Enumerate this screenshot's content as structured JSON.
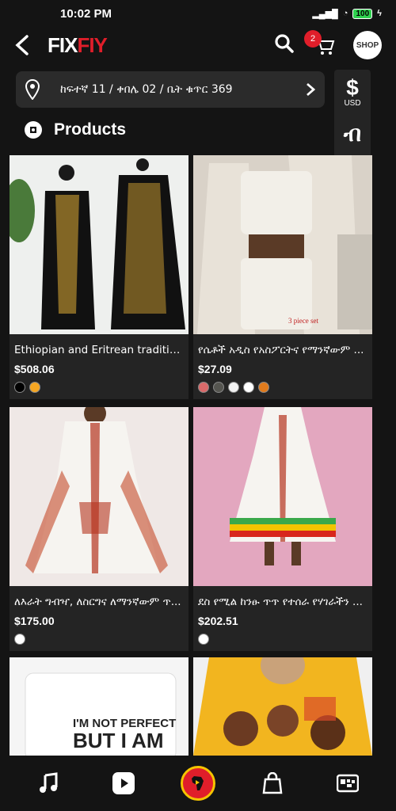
{
  "status": {
    "time": "10:02 PM",
    "battery": "100"
  },
  "header": {
    "logo_a": "FIX",
    "logo_b": "FIY",
    "cart_count": "2",
    "shop_label": "SHOP"
  },
  "address": {
    "text": "ከፍተኛ 11 / ቀበሌ 02 / ቤት ቁጥር 369"
  },
  "currencies": [
    {
      "symbol": "$",
      "label": "USD"
    },
    {
      "symbol": "ብ",
      "label": ""
    },
    {
      "symbol": "£",
      "label": ""
    },
    {
      "symbol": "€",
      "label": ""
    }
  ],
  "section": {
    "title": "Products"
  },
  "products": [
    {
      "name": "Ethiopian and Eritrean traditiona...",
      "price": "$508.06",
      "swatches": [
        "#000000",
        "#f5a623"
      ]
    },
    {
      "name": "የሴቶች አዲስ የአስፖርትና የማንኛውም ...",
      "price": "$27.09",
      "swatches": [
        "#d96a6a",
        "#555550",
        "#f2f2f2",
        "#ffffff",
        "#e07b1d"
      ]
    },
    {
      "name": "ለእራት ግብዣ, ለስርግና ለማንኛውም ጥ...",
      "price": "$175.00",
      "swatches": [
        "#ffffff"
      ]
    },
    {
      "name": "ደስ የሚል ከንፁ ጥጥ የተሰራ የሃገራችን ...",
      "price": "$202.51",
      "swatches": [
        "#ffffff"
      ]
    },
    {
      "name": "",
      "price": "",
      "swatches": [],
      "mug_text": "I'M NOT PERFECT BUT I AM"
    },
    {
      "name": "",
      "price": "",
      "swatches": []
    }
  ],
  "colors": {
    "accent": "#e01e2a",
    "bg": "#141414",
    "card": "#242424"
  }
}
